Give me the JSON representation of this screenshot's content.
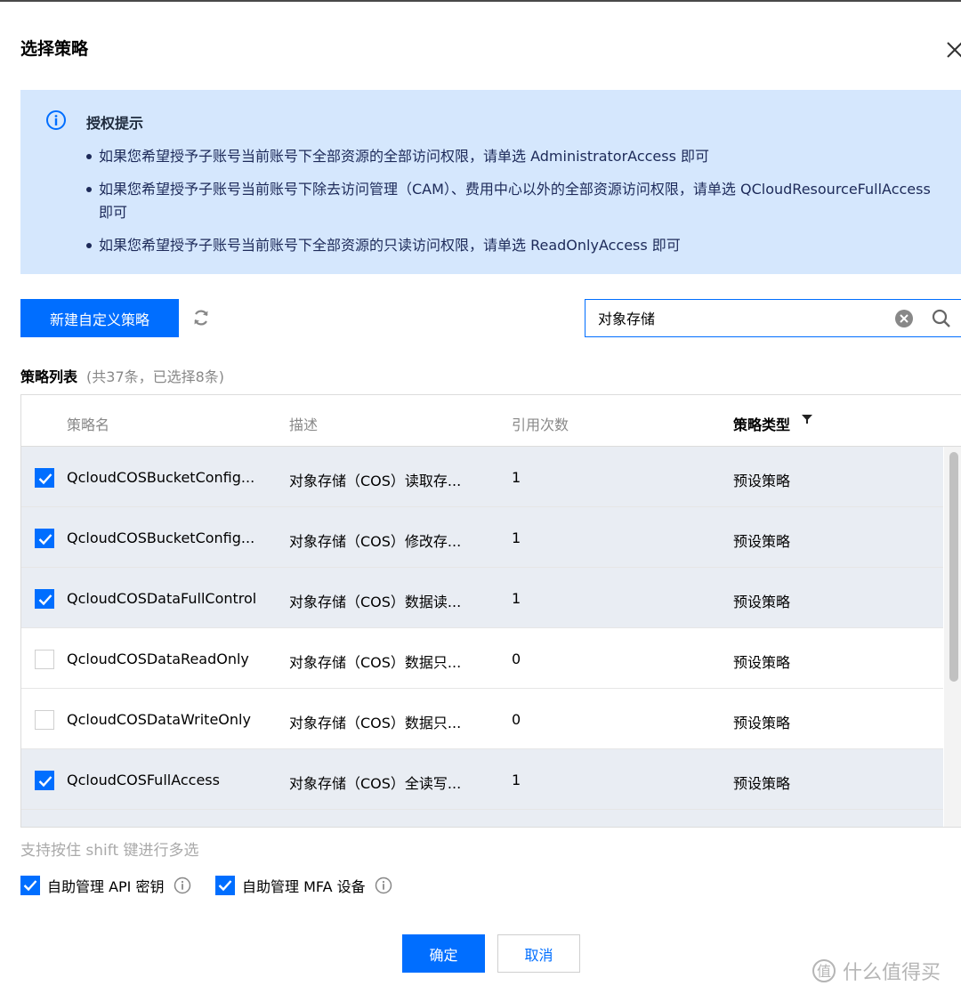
{
  "dialog": {
    "title": "选择策略"
  },
  "notice": {
    "title": "授权提示",
    "items": [
      "如果您希望授予子账号当前账号下全部资源的全部访问权限，请单选 AdministratorAccess 即可",
      "如果您希望授予子账号当前账号下除去访问管理（CAM）、费用中心以外的全部资源访问权限，请单选 QCloudResourceFullAccess 即可",
      "如果您希望授予子账号当前账号下全部资源的只读访问权限，请单选 ReadOnlyAccess 即可"
    ]
  },
  "toolbar": {
    "create_label": "新建自定义策略"
  },
  "search": {
    "value": "对象存储"
  },
  "list": {
    "title": "策略列表",
    "summary": "(共37条，已选择8条)"
  },
  "table": {
    "headers": {
      "name": "策略名",
      "desc": "描述",
      "ref": "引用次数",
      "type": "策略类型"
    },
    "rows": [
      {
        "checked": true,
        "name": "QcloudCOSBucketConfig...",
        "desc": "对象存储（COS）读取存...",
        "ref": "1",
        "type": "预设策略"
      },
      {
        "checked": true,
        "name": "QcloudCOSBucketConfig...",
        "desc": "对象存储（COS）修改存...",
        "ref": "1",
        "type": "预设策略"
      },
      {
        "checked": true,
        "name": "QcloudCOSDataFullControl",
        "desc": "对象存储（COS）数据读...",
        "ref": "1",
        "type": "预设策略"
      },
      {
        "checked": false,
        "name": "QcloudCOSDataReadOnly",
        "desc": "对象存储（COS）数据只...",
        "ref": "0",
        "type": "预设策略"
      },
      {
        "checked": false,
        "name": "QcloudCOSDataWriteOnly",
        "desc": "对象存储（COS）数据只...",
        "ref": "0",
        "type": "预设策略"
      },
      {
        "checked": true,
        "name": "QcloudCOSFullAccess",
        "desc": "对象存储（COS）全读写...",
        "ref": "1",
        "type": "预设策略"
      }
    ]
  },
  "hint": "支持按住 shift 键进行多选",
  "options": [
    {
      "label": "自助管理 API 密钥",
      "checked": true
    },
    {
      "label": "自助管理 MFA 设备",
      "checked": true
    }
  ],
  "actions": {
    "ok_label": "确定",
    "cancel_label": "取消"
  },
  "watermark": "什么值得买",
  "colors": {
    "primary": "#006eff",
    "notice_bg": "#d5e7fd",
    "selected_row": "#e9edf3"
  }
}
